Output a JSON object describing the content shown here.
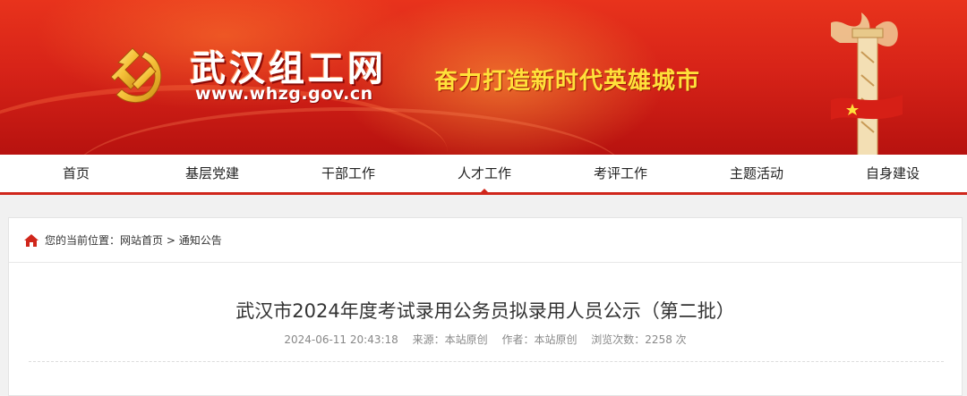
{
  "header": {
    "site_name": "武汉组工网",
    "site_url": "www.whzg.gov.cn",
    "slogan": "奋力打造新时代英雄城市"
  },
  "nav": {
    "items": [
      {
        "label": "首页"
      },
      {
        "label": "基层党建"
      },
      {
        "label": "干部工作"
      },
      {
        "label": "人才工作",
        "active": true
      },
      {
        "label": "考评工作"
      },
      {
        "label": "主题活动"
      },
      {
        "label": "自身建设"
      }
    ]
  },
  "breadcrumb": {
    "prefix": "您的当前位置：",
    "home": "网站首页",
    "separator": " > ",
    "current": "通知公告"
  },
  "article": {
    "title": "武汉市2024年度考试录用公务员拟录用人员公示（第二批）",
    "datetime": "2024-06-11 20:43:18",
    "source": "来源：本站原创",
    "author": "作者：本站原创",
    "views": "浏览次数：2258 次"
  },
  "colors": {
    "brand_red": "#d0261b",
    "slogan_yellow": "#ffe03a"
  }
}
